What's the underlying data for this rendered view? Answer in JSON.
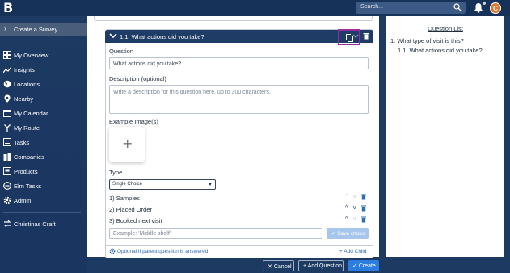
{
  "app": {
    "logo_letter": "B"
  },
  "topbar": {
    "search_placeholder": "Search...",
    "avatar_initial": "C"
  },
  "sidebar": {
    "create_survey": "Create a Survey",
    "items": [
      {
        "label": "My Overview",
        "icon": "grid-icon"
      },
      {
        "label": "Insights",
        "icon": "trend-icon"
      },
      {
        "label": "Locations",
        "icon": "globe-icon"
      },
      {
        "label": "Nearby",
        "icon": "pin-icon"
      },
      {
        "label": "My Calendar",
        "icon": "calendar-icon"
      },
      {
        "label": "My Route",
        "icon": "route-icon"
      },
      {
        "label": "Tasks",
        "icon": "tasks-icon"
      },
      {
        "label": "Companies",
        "icon": "building-icon"
      },
      {
        "label": "Products",
        "icon": "book-icon"
      },
      {
        "label": "Elm Tasks",
        "icon": "elm-icon"
      },
      {
        "label": "Admin",
        "icon": "gear-icon"
      }
    ],
    "account": "Christinas Craft"
  },
  "question": {
    "header": "1.1. What actions did you take?",
    "question_label": "Question",
    "question_value": "What actions did you take?",
    "description_label": "Description (optional)",
    "description_placeholder": "Write a description for this question here, up to 300 characters.",
    "images_label": "Example Image(s)",
    "type_label": "Type",
    "type_value": "Single Choice",
    "choices": [
      "1) Samples",
      "2) Placed Order",
      "3) Booked next visit"
    ],
    "choice_placeholder": "Example: 'Middle shelf'",
    "save_choice": "Save choice",
    "optional_link": "Optional if parent question is answered",
    "add_child": "Add Child"
  },
  "question_list": {
    "title": "Question List",
    "items": [
      "1. What type of visit is this?",
      "1.1. What actions did you take?"
    ]
  },
  "footer": {
    "cancel": "Cancel",
    "add_question": "Add Question",
    "create": "Create"
  },
  "colors": {
    "nav_bg": "#1d3a63",
    "header_bg": "#1e3c66",
    "accent": "#2b7de1",
    "highlight": "#9b2aa2"
  }
}
